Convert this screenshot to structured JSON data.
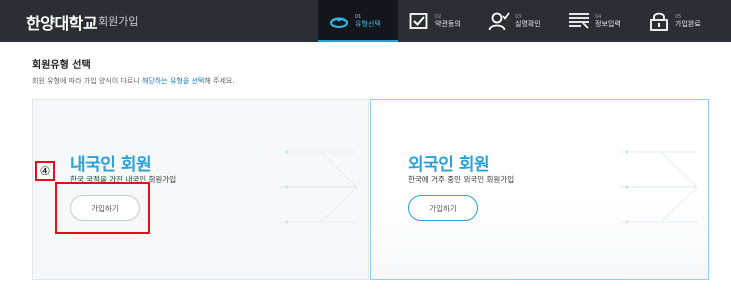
{
  "header": {
    "brand": "한양대학교",
    "brand_sub": "회원가입",
    "steps": [
      {
        "num": "01",
        "label": "유형선택",
        "icon": "user-type-icon",
        "active": true
      },
      {
        "num": "02",
        "label": "약관동의",
        "icon": "checkbox-icon",
        "active": false
      },
      {
        "num": "03",
        "label": "실명확인",
        "icon": "user-check-icon",
        "active": false
      },
      {
        "num": "04",
        "label": "정보입력",
        "icon": "form-list-icon",
        "active": false
      },
      {
        "num": "05",
        "label": "가입완료",
        "icon": "lock-icon",
        "active": false
      }
    ]
  },
  "main": {
    "section_title": "회원유형 선택",
    "desc_before": "회원 유형에 따라 가입 양식이 다르니 ",
    "desc_highlight": "해당하는 유형을 선택",
    "desc_after": "해 주세요.",
    "cards": [
      {
        "title": "내국인 회원",
        "subtitle": "한국 국적을 가진 내국인 회원가입",
        "button": "가입하기"
      },
      {
        "title": "외국인 회원",
        "subtitle": "한국에 거주 중인 외국인 회원가입",
        "button": "가입하기"
      }
    ]
  },
  "annotation": {
    "badge": "④",
    "color": "#e2101d"
  },
  "colors": {
    "header_bg": "#2b2f35",
    "accent": "#2aa1d7",
    "annotation": "#e2101d"
  }
}
